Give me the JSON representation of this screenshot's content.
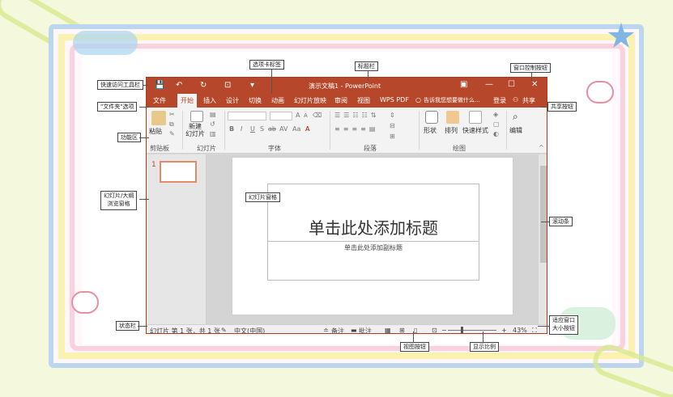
{
  "window": {
    "title": "演示文稿1 - PowerPoint",
    "controls": {
      "ribbon_display": "▣",
      "minimize": "—",
      "maximize": "☐",
      "close": "✕"
    }
  },
  "quick_access": {
    "save": "💾",
    "undo": "↶",
    "redo": "↻",
    "present": "⊡",
    "customize": "▾"
  },
  "tabs": [
    "文件",
    "开始",
    "插入",
    "设计",
    "切换",
    "动画",
    "幻灯片放映",
    "审阅",
    "视图",
    "WPS PDF"
  ],
  "tell_me": "告诉我您想要做什么...",
  "account": {
    "login": "登录",
    "share": "共享"
  },
  "ribbon": {
    "groups": [
      "剪贴板",
      "幻灯片",
      "字体",
      "段落",
      "绘图"
    ],
    "paste": "粘贴",
    "new_slide": "新建\n幻灯片",
    "shapes": "形状",
    "arrange": "排列",
    "quick_styles": "快速样式",
    "editing": "编辑",
    "font_buttons": [
      "B",
      "I",
      "U",
      "S",
      "ab",
      "AV",
      "Aa",
      "A"
    ],
    "font_grow": "A",
    "font_shrink": "A",
    "collapse": "^"
  },
  "thumbnail": {
    "number": "1"
  },
  "slide": {
    "title_placeholder": "单击此处添加标题",
    "subtitle_placeholder": "单击此处添加副标题"
  },
  "status": {
    "slide_info": "幻灯片 第 1 张，共 1 张",
    "language": "中文(中国)",
    "notes": "备注",
    "comments": "批注",
    "zoom_minus": "−",
    "zoom_plus": "+",
    "zoom": "43%"
  },
  "annotations": {
    "tab_labels": "选项卡标签",
    "title_bar": "标题栏",
    "window_controls": "窗口控制按钮",
    "quick_access": "快速访问工具栏",
    "file_tab": "\"文件夹\"选项",
    "ribbon": "功能区",
    "share_button": "共享按钮",
    "slide_pane": "幻灯片窗格",
    "outline_pane_1": "幻灯片/大纲",
    "outline_pane_2": "浏览窗格",
    "scrollbar": "滚动条",
    "statusbar": "状态栏",
    "fit_window_1": "适应窗口",
    "fit_window_2": "大小按钮",
    "view_buttons": "视图按钮",
    "zoom_ratio": "显示比例"
  }
}
